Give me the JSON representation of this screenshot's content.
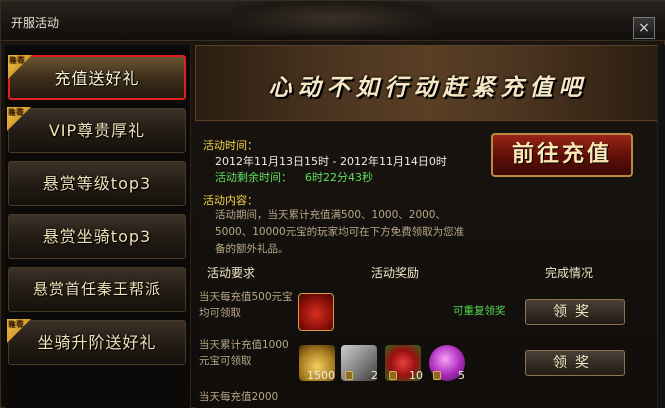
{
  "window": {
    "title": "开服活动",
    "close_label": "×"
  },
  "sidebar": {
    "items": [
      {
        "label": "充值送好礼",
        "badge": "推荐",
        "active": true
      },
      {
        "label": "VIP尊贵厚礼",
        "badge": "推荐",
        "active": false
      },
      {
        "label": "悬赏等级top3",
        "badge": "",
        "active": false
      },
      {
        "label": "悬赏坐骑top3",
        "badge": "",
        "active": false
      },
      {
        "label": "悬赏首任秦王帮派",
        "badge": "",
        "active": false
      },
      {
        "label": "坐骑升阶送好礼",
        "badge": "推荐",
        "active": false
      }
    ]
  },
  "banner": {
    "text": "心动不如行动赶紧充值吧"
  },
  "info": {
    "time_label": "活动时间：",
    "time_range": "2012年11月13日15时 - 2012年11月14日0时",
    "remaining_label": "活动剩余时间：",
    "remaining_value": "6时22分43秒",
    "content_label": "活动内容：",
    "content_text": "活动期间，当天累计充值满500、1000、2000、5000、10000元宝的玩家均可在下方免费领取为您准备的额外礼品。"
  },
  "goto_button": "前往充值",
  "table": {
    "headers": {
      "requirement": "活动要求",
      "reward": "活动奖励",
      "status": "完成情况"
    },
    "rows": [
      {
        "requirement": "当天每充值500元宝均可领取",
        "note": "可重复领奖",
        "claim": "领奖"
      },
      {
        "requirement": "当天累计充值1000元宝可领取",
        "note": "",
        "claim": "领奖"
      },
      {
        "requirement": "当天每充值2000",
        "note": "",
        "claim": ""
      }
    ],
    "reward_counts": {
      "ingot": "1500",
      "scroll": "2",
      "rose": "10",
      "orb": "5"
    }
  },
  "colors": {
    "active_border": "#e02020",
    "label_yellow": "#f2d24a",
    "remaining_green": "#5fe05f",
    "goto_red": "#9a2418"
  }
}
